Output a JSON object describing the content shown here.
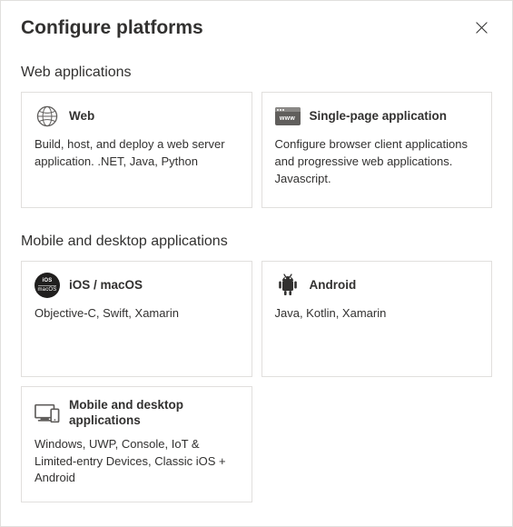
{
  "title": "Configure platforms",
  "sections": {
    "web": {
      "heading": "Web applications",
      "cards": {
        "web": {
          "title": "Web",
          "desc": "Build, host, and deploy a web server application. .NET, Java, Python",
          "icon": "globe-icon"
        },
        "spa": {
          "title": "Single-page application",
          "desc": "Configure browser client applications and progressive web applications. Javascript.",
          "icon": "browser-www-icon",
          "www_label": "www"
        }
      }
    },
    "mobile": {
      "heading": "Mobile and desktop applications",
      "cards": {
        "ios": {
          "title": "iOS / macOS",
          "desc": "Objective-C, Swift, Xamarin",
          "icon": "ios-macos-icon",
          "badge_line1": "iOS",
          "badge_line2": "macOS"
        },
        "android": {
          "title": "Android",
          "desc": "Java, Kotlin, Xamarin",
          "icon": "android-icon"
        },
        "desktop": {
          "title": "Mobile and desktop applications",
          "desc": "Windows, UWP, Console, IoT & Limited-entry Devices, Classic iOS + Android",
          "icon": "desktop-icon"
        }
      }
    }
  }
}
